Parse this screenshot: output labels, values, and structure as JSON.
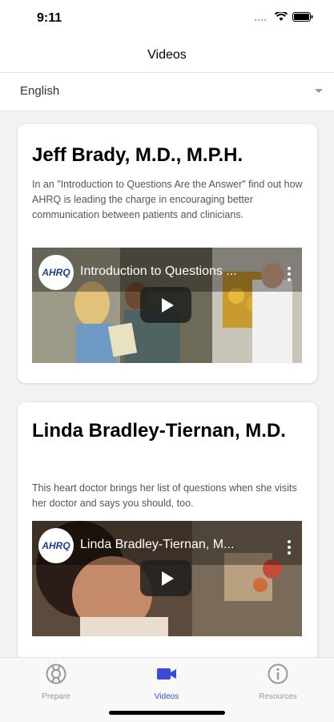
{
  "status": {
    "time": "9:11"
  },
  "nav": {
    "title": "Videos"
  },
  "language": {
    "selected": "English"
  },
  "cards": [
    {
      "title": "Jeff Brady, M.D., M.P.H.",
      "description": "In an \"Introduction to Questions Are the Answer\" find out how AHRQ is leading the charge in encouraging better communication between patients and clinicians.",
      "video_title": "Introduction to Questions ...",
      "logo_text": "AHRQ"
    },
    {
      "title": "Linda Bradley-Tiernan, M.D.",
      "description": "This heart doctor brings her list of questions when she visits her doctor and says you should, too.",
      "video_title": "Linda Bradley-Tiernan, M...",
      "logo_text": "AHRQ"
    }
  ],
  "tabs": [
    {
      "label": "Prepare",
      "icon": "lifebuoy-icon"
    },
    {
      "label": "Videos",
      "icon": "video-camera-icon",
      "active": true
    },
    {
      "label": "Resources",
      "icon": "info-circle-icon"
    }
  ],
  "colors": {
    "accent": "#3b4bd8"
  }
}
